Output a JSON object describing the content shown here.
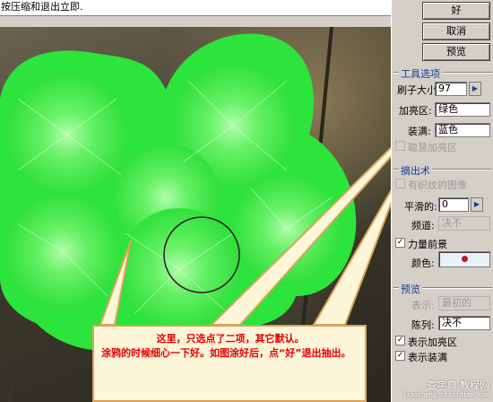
{
  "hint": {
    "text": "按压缩和退出立即."
  },
  "buttons": {
    "ok": "好",
    "cancel": "取消",
    "preview": "预览"
  },
  "tool_options": {
    "title": "工具选项",
    "brush_size_label": "刷子大小:",
    "brush_size_value": "97",
    "highlight_label": "加亮区:",
    "highlight_value": "绿色",
    "fill_label": "装满:",
    "fill_value": "蓝色",
    "smart_highlight_label": "聪慧加亮区"
  },
  "extraction": {
    "title": "摘出术",
    "textured_label": "有织纹的图像",
    "smooth_label": "平滑的:",
    "smooth_value": "0",
    "channel_label": "频道:",
    "channel_value": "决不",
    "force_fg_label": "力量前景",
    "color_label": "颜色:"
  },
  "preview_group": {
    "title": "预览",
    "show_label": "表示:",
    "show_value": "最初的",
    "display_label": "陈列:",
    "display_value": "决不",
    "show_highlight_label": "表示加亮区",
    "show_fill_label": "表示装满"
  },
  "annotation": {
    "line1": "这里，只选点了二项，其它默认。",
    "line2": "涂鸦的时候细心一下好。如图涂好后，点“好”退出抽出。"
  },
  "watermark": {
    "line1": "查字典 教程网",
    "line2": "jiaocheng.chazidian.com"
  },
  "colors": {
    "highlight": "#33ee44",
    "accent": "#1a3a9a",
    "note_border": "#d8a55c",
    "note_text": "#e60000"
  }
}
